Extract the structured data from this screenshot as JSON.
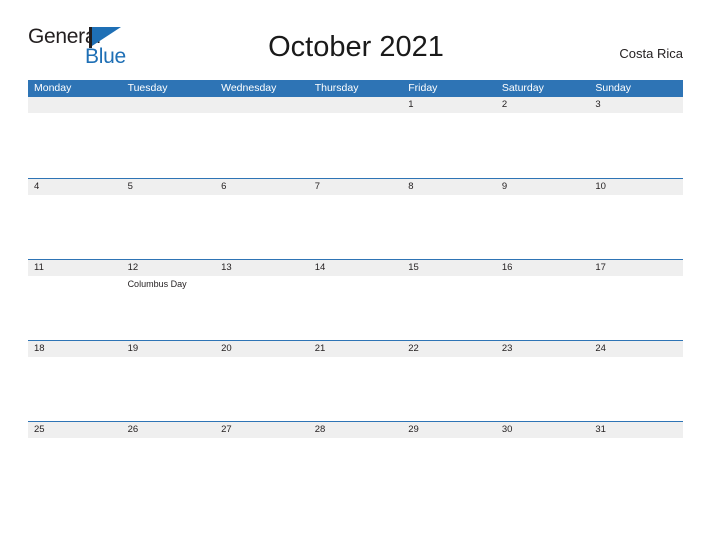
{
  "brand": {
    "name_part1": "General",
    "name_part2": "Blue",
    "flag_icon": "flag-triangle-icon",
    "colors": {
      "dark": "#231f20",
      "blue": "#1e6fb5"
    }
  },
  "header": {
    "title": "October 2021",
    "region": "Costa Rica"
  },
  "calendar": {
    "colors": {
      "header_band": "#2e74b5",
      "date_band": "#efefef",
      "rule": "#2e74b5",
      "text": "#231f20"
    },
    "weekdays": [
      "Monday",
      "Tuesday",
      "Wednesday",
      "Thursday",
      "Friday",
      "Saturday",
      "Sunday"
    ],
    "weeks": [
      {
        "days": [
          {
            "num": "",
            "events": []
          },
          {
            "num": "",
            "events": []
          },
          {
            "num": "",
            "events": []
          },
          {
            "num": "",
            "events": []
          },
          {
            "num": "1",
            "events": []
          },
          {
            "num": "2",
            "events": []
          },
          {
            "num": "3",
            "events": []
          }
        ]
      },
      {
        "days": [
          {
            "num": "4",
            "events": []
          },
          {
            "num": "5",
            "events": []
          },
          {
            "num": "6",
            "events": []
          },
          {
            "num": "7",
            "events": []
          },
          {
            "num": "8",
            "events": []
          },
          {
            "num": "9",
            "events": []
          },
          {
            "num": "10",
            "events": []
          }
        ]
      },
      {
        "days": [
          {
            "num": "11",
            "events": []
          },
          {
            "num": "12",
            "events": [
              "Columbus Day"
            ]
          },
          {
            "num": "13",
            "events": []
          },
          {
            "num": "14",
            "events": []
          },
          {
            "num": "15",
            "events": []
          },
          {
            "num": "16",
            "events": []
          },
          {
            "num": "17",
            "events": []
          }
        ]
      },
      {
        "days": [
          {
            "num": "18",
            "events": []
          },
          {
            "num": "19",
            "events": []
          },
          {
            "num": "20",
            "events": []
          },
          {
            "num": "21",
            "events": []
          },
          {
            "num": "22",
            "events": []
          },
          {
            "num": "23",
            "events": []
          },
          {
            "num": "24",
            "events": []
          }
        ]
      },
      {
        "days": [
          {
            "num": "25",
            "events": []
          },
          {
            "num": "26",
            "events": []
          },
          {
            "num": "27",
            "events": []
          },
          {
            "num": "28",
            "events": []
          },
          {
            "num": "29",
            "events": []
          },
          {
            "num": "30",
            "events": []
          },
          {
            "num": "31",
            "events": []
          }
        ]
      }
    ]
  }
}
